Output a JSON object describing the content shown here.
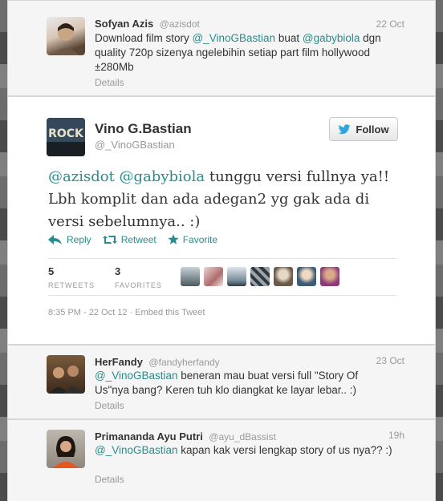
{
  "top_reply": {
    "name": "Sofyan Azis",
    "handle": "@azisdot",
    "time": "22 Oct",
    "mention1": "@_VinoGBastian",
    "text1": " buat ",
    "mention2": "@gabybiola",
    "text_pre": "Download film story ",
    "text_post": " dgn quality 720p sizenya ngelebihin setiap part film hollywood ±280Mb",
    "details": "Details"
  },
  "main_tweet": {
    "name": "Vino G.Bastian",
    "handle": "@_VinoGBastian",
    "avatar_text": "ROCK",
    "follow_label": "Follow",
    "mention1": "@azisdot",
    "mention2": "@gabybiola",
    "text": " tunggu versi fullnya ya!! Lbh komplit dan ada adegan2 yg gak ada di versi sebelumnya.. :)",
    "actions": {
      "reply": "Reply",
      "retweet": "Retweet",
      "favorite": "Favorite"
    },
    "retweets_count": "5",
    "retweets_label": "RETWEETS",
    "favorites_count": "3",
    "favorites_label": "FAVORITES",
    "meta": "8:35 PM - 22 Oct 12 · Embed this Tweet"
  },
  "replies": [
    {
      "name": "HerFandy",
      "handle": "@fandyherfandy",
      "time": "23 Oct",
      "mention": "@_VinoGBastian",
      "text": " beneran mau buat versi full \"Story Of Us\"nya bang? Keren tuh klo diangkat ke layar lebar.. :)",
      "details": "Details"
    },
    {
      "name": "Primananda Ayu Putri",
      "handle": "@ayu_dBassist",
      "time": "19h",
      "mention": "@_VinoGBastian",
      "text": " kapan kak versi lengkap story of us nya?? :)",
      "details": "Details"
    }
  ],
  "colors": {
    "accent": "#2a8c8c",
    "twitter_bird": "#2ba6de"
  }
}
